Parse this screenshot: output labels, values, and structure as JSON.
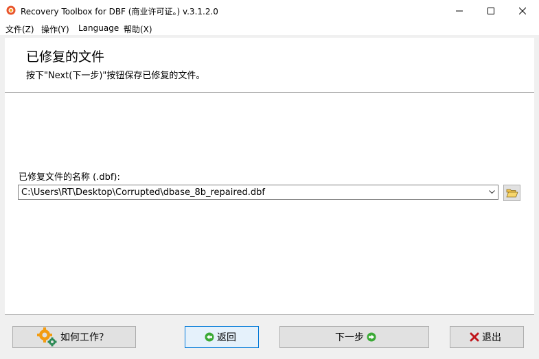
{
  "window": {
    "title": "Recovery Toolbox for DBF (商业许可证。) v.3.1.2.0",
    "icon": "app-logo-icon",
    "controls": [
      "minimize",
      "maximize",
      "close"
    ]
  },
  "menu": {
    "items": [
      "文件(Z)",
      "操作(Y)",
      "Language",
      "帮助(X)"
    ]
  },
  "header": {
    "title": "已修复的文件",
    "subtitle": "按下\"Next(下一步)\"按钮保存已修复的文件。"
  },
  "form": {
    "file_label": "已修复文件的名称 (.dbf):",
    "path_value": "C:\\Users\\RT\\Desktop\\Corrupted\\dbase_8b_repaired.dbf",
    "browse_icon": "folder-open-icon"
  },
  "buttons": {
    "how_label": "如何工作？",
    "back_label": "返回",
    "next_label": "下一步",
    "exit_label": "退出"
  },
  "colors": {
    "accent": "#0078d7",
    "back_icon": "#3aa935",
    "exit_icon": "#c0161c",
    "gear_icon": "#f39c12",
    "gear_small_icon": "#2e8b57"
  }
}
